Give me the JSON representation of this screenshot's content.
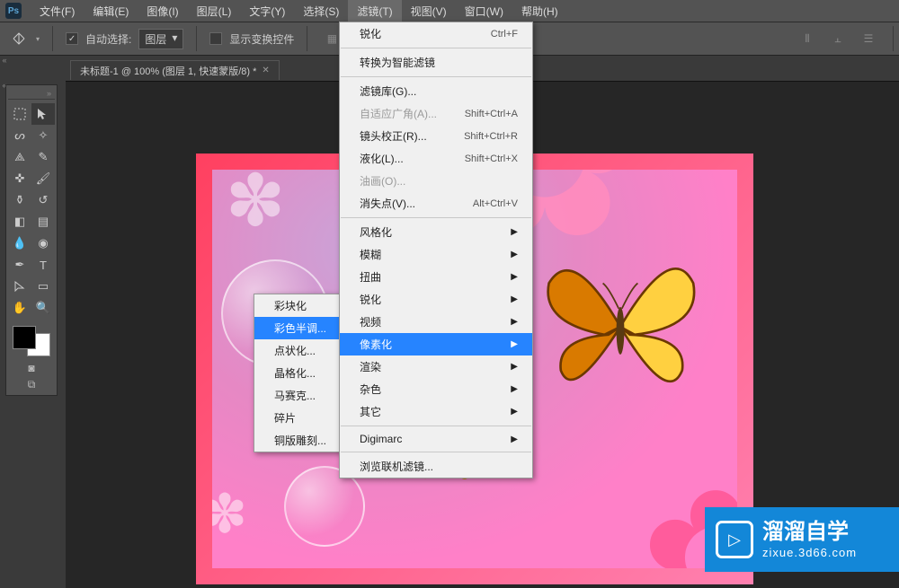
{
  "menubar": {
    "items": [
      "文件(F)",
      "编辑(E)",
      "图像(I)",
      "图层(L)",
      "文字(Y)",
      "选择(S)",
      "滤镜(T)",
      "视图(V)",
      "窗口(W)",
      "帮助(H)"
    ],
    "activeIndex": 6
  },
  "optionsBar": {
    "autoSelect": "自动选择:",
    "autoSelectTarget": "图层",
    "showTransform": "显示变换控件",
    "autoChecked": "✓"
  },
  "fileTab": {
    "label": "未标题-1 @ 100% (图层 1, 快速蒙版/8) *"
  },
  "filterMenu": {
    "recent": {
      "label": "锐化",
      "shortcut": "Ctrl+F"
    },
    "convertSmart": "转换为智能滤镜",
    "gallery": "滤镜库(G)...",
    "adaptive": {
      "label": "自适应广角(A)...",
      "shortcut": "Shift+Ctrl+A"
    },
    "lens": {
      "label": "镜头校正(R)...",
      "shortcut": "Shift+Ctrl+R"
    },
    "liquify": {
      "label": "液化(L)...",
      "shortcut": "Shift+Ctrl+X"
    },
    "oil": "油画(O)...",
    "vanish": {
      "label": "消失点(V)...",
      "shortcut": "Alt+Ctrl+V"
    },
    "groups": [
      "风格化",
      "模糊",
      "扭曲",
      "锐化",
      "视频",
      "像素化",
      "渲染",
      "杂色",
      "其它"
    ],
    "digimarc": "Digimarc",
    "browse": "浏览联机滤镜...",
    "highlightIndex": 5
  },
  "pixelateSub": {
    "items": [
      "彩块化",
      "彩色半调...",
      "点状化...",
      "晶格化...",
      "马赛克...",
      "碎片",
      "铜版雕刻..."
    ],
    "highlightIndex": 1
  },
  "watermark": {
    "title": "溜溜自学",
    "sub": "zixue.3d66.com"
  }
}
